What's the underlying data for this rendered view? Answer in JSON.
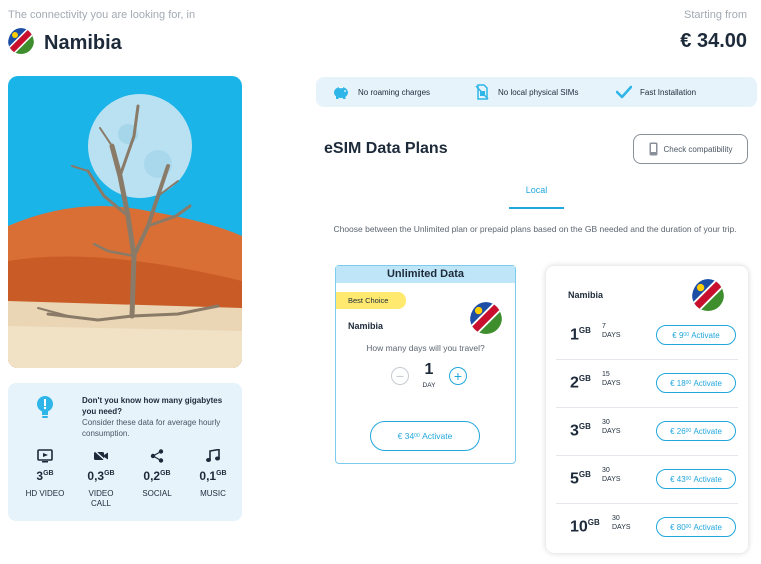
{
  "header": {
    "tagline": "The connectivity you are looking for, in",
    "country": "Namibia",
    "starting_from_label": "Starting from",
    "starting_price": "€ 34.00",
    "flag_icon": "namibia-flag-icon"
  },
  "hero": {
    "description_icon": "dead-tree-desert-moon-image"
  },
  "gb_guide": {
    "title": "Don't you know how many gigabytes you need?",
    "subtitle": "Consider these data for average hourly consumption.",
    "items": [
      {
        "icon": "video-icon",
        "amount": "3",
        "unit": "GB",
        "label": "HD VIDEO"
      },
      {
        "icon": "video-call-icon",
        "amount": "0,3",
        "unit": "GB",
        "label": "VIDEO CALL"
      },
      {
        "icon": "share-icon",
        "amount": "0,2",
        "unit": "GB",
        "label": "SOCIAL"
      },
      {
        "icon": "music-icon",
        "amount": "0,1",
        "unit": "GB",
        "label": "MUSIC"
      }
    ]
  },
  "features": [
    {
      "icon": "piggy-bank-icon",
      "label": "No roaming charges"
    },
    {
      "icon": "no-sim-icon",
      "label": "No local physical SIMs"
    },
    {
      "icon": "checkmark-icon",
      "label": "Fast Installation"
    }
  ],
  "plans": {
    "title": "eSIM Data Plans",
    "check_compatibility": "Check compatibility",
    "tab_local": "Local",
    "description": "Choose between the Unlimited plan or prepaid plans based on the GB needed and the duration of your trip."
  },
  "unlimited": {
    "header": "Unlimited Data",
    "badge": "Best Choice",
    "country": "Namibia",
    "question": "How many days will you travel?",
    "days_value": "1",
    "days_unit": "DAY",
    "minus": "−",
    "plus": "+",
    "price_main": "€ 34",
    "price_cents": "00",
    "activate": "Activate"
  },
  "prepaid": {
    "country": "Namibia",
    "rows": [
      {
        "gb": "1",
        "gb_unit": "GB",
        "days": "7",
        "days_unit": "DAYS",
        "price_main": "€ 9",
        "price_cents": "00",
        "activate": "Activate"
      },
      {
        "gb": "2",
        "gb_unit": "GB",
        "days": "15",
        "days_unit": "DAYS",
        "price_main": "€ 18",
        "price_cents": "00",
        "activate": "Activate"
      },
      {
        "gb": "3",
        "gb_unit": "GB",
        "days": "30",
        "days_unit": "DAYS",
        "price_main": "€ 26",
        "price_cents": "00",
        "activate": "Activate"
      },
      {
        "gb": "5",
        "gb_unit": "GB",
        "days": "30",
        "days_unit": "DAYS",
        "price_main": "€ 43",
        "price_cents": "00",
        "activate": "Activate"
      },
      {
        "gb": "10",
        "gb_unit": "GB",
        "days": "30",
        "days_unit": "DAYS",
        "price_main": "€ 80",
        "price_cents": "00",
        "activate": "Activate"
      }
    ]
  },
  "colors": {
    "accent": "#22a7dd",
    "light_panel": "#e6f3fb",
    "badge": "#ffe96e",
    "text": "#1d2a3a"
  }
}
